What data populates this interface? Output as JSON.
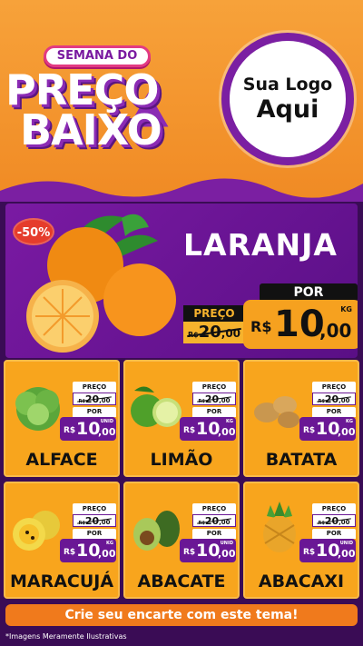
{
  "header": {
    "tag": "SEMANA DO",
    "line1": "PREÇO",
    "line2": "BAIXO",
    "logo_line1": "Sua Logo",
    "logo_line2": "Aqui"
  },
  "hero": {
    "discount": "-50%",
    "title": "LARANJA",
    "old_label": "PREÇO",
    "old_currency": "R$",
    "old_int": "20",
    "old_cents": ",00",
    "new_label": "POR",
    "new_currency": "R$",
    "new_int": "10",
    "new_cents": ",00",
    "unit": "KG"
  },
  "products": [
    {
      "name": "ALFACE",
      "old_label": "PREÇO",
      "old_currency": "R$",
      "old_int": "20",
      "old_cents": ",00",
      "new_label": "POR",
      "new_currency": "R$",
      "new_int": "10",
      "new_cents": ",00",
      "unit": "UNID"
    },
    {
      "name": "LIMÃO",
      "old_label": "PREÇO",
      "old_currency": "R$",
      "old_int": "20",
      "old_cents": ",00",
      "new_label": "POR",
      "new_currency": "R$",
      "new_int": "10",
      "new_cents": ",00",
      "unit": "KG"
    },
    {
      "name": "BATATA",
      "old_label": "PREÇO",
      "old_currency": "R$",
      "old_int": "20",
      "old_cents": ",00",
      "new_label": "POR",
      "new_currency": "R$",
      "new_int": "10",
      "new_cents": ",00",
      "unit": "KG"
    },
    {
      "name": "MARACUJÁ",
      "old_label": "PREÇO",
      "old_currency": "R$",
      "old_int": "20",
      "old_cents": ",00",
      "new_label": "POR",
      "new_currency": "R$",
      "new_int": "10",
      "new_cents": ",00",
      "unit": "KG"
    },
    {
      "name": "ABACATE",
      "old_label": "PREÇO",
      "old_currency": "R$",
      "old_int": "20",
      "old_cents": ",00",
      "new_label": "POR",
      "new_currency": "R$",
      "new_int": "10",
      "new_cents": ",00",
      "unit": "UNID"
    },
    {
      "name": "ABACAXI",
      "old_label": "PREÇO",
      "old_currency": "R$",
      "old_int": "20",
      "old_cents": ",00",
      "new_label": "POR",
      "new_currency": "R$",
      "new_int": "10",
      "new_cents": ",00",
      "unit": "UNID"
    }
  ],
  "footer": {
    "cta": "Crie seu encarte com este tema!",
    "disclaimer": "*Imagens Meramente Ilustrativas"
  },
  "colors": {
    "orange": "#f8a51d",
    "purple": "#6a1795",
    "header_orange": "#f08a24"
  }
}
